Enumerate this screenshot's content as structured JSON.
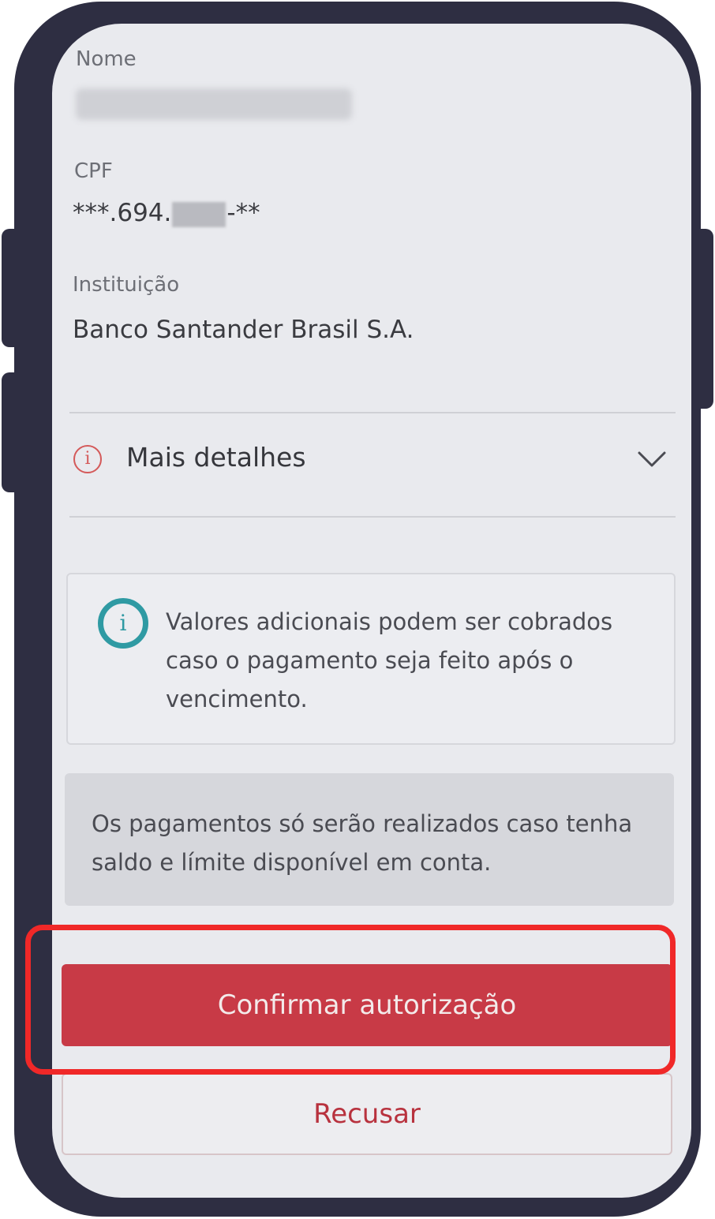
{
  "form": {
    "name_label": "Nome",
    "cpf_label": "CPF",
    "cpf_prefix": "***.694.",
    "cpf_suffix": "-**",
    "institution_label": "Instituição",
    "institution_value": "Banco Santander Brasil S.A."
  },
  "details": {
    "label": "Mais detalhes",
    "info_icon": "info-outline-icon",
    "chevron_icon": "chevron-down-icon"
  },
  "notice": {
    "icon": "info-icon",
    "text": "Valores adicionais podem ser cobrados caso o pagamento seja feito após o vencimento."
  },
  "balance_note": {
    "text": "Os pagamentos só serão realizados caso tenha saldo e límite disponível em conta."
  },
  "actions": {
    "confirm_label": "Confirmar autorização",
    "refuse_label": "Recusar"
  },
  "colors": {
    "primary": "#c83a46",
    "info_teal": "#2f9aa3",
    "highlight": "#f02828",
    "frame": "#2e2e42"
  }
}
